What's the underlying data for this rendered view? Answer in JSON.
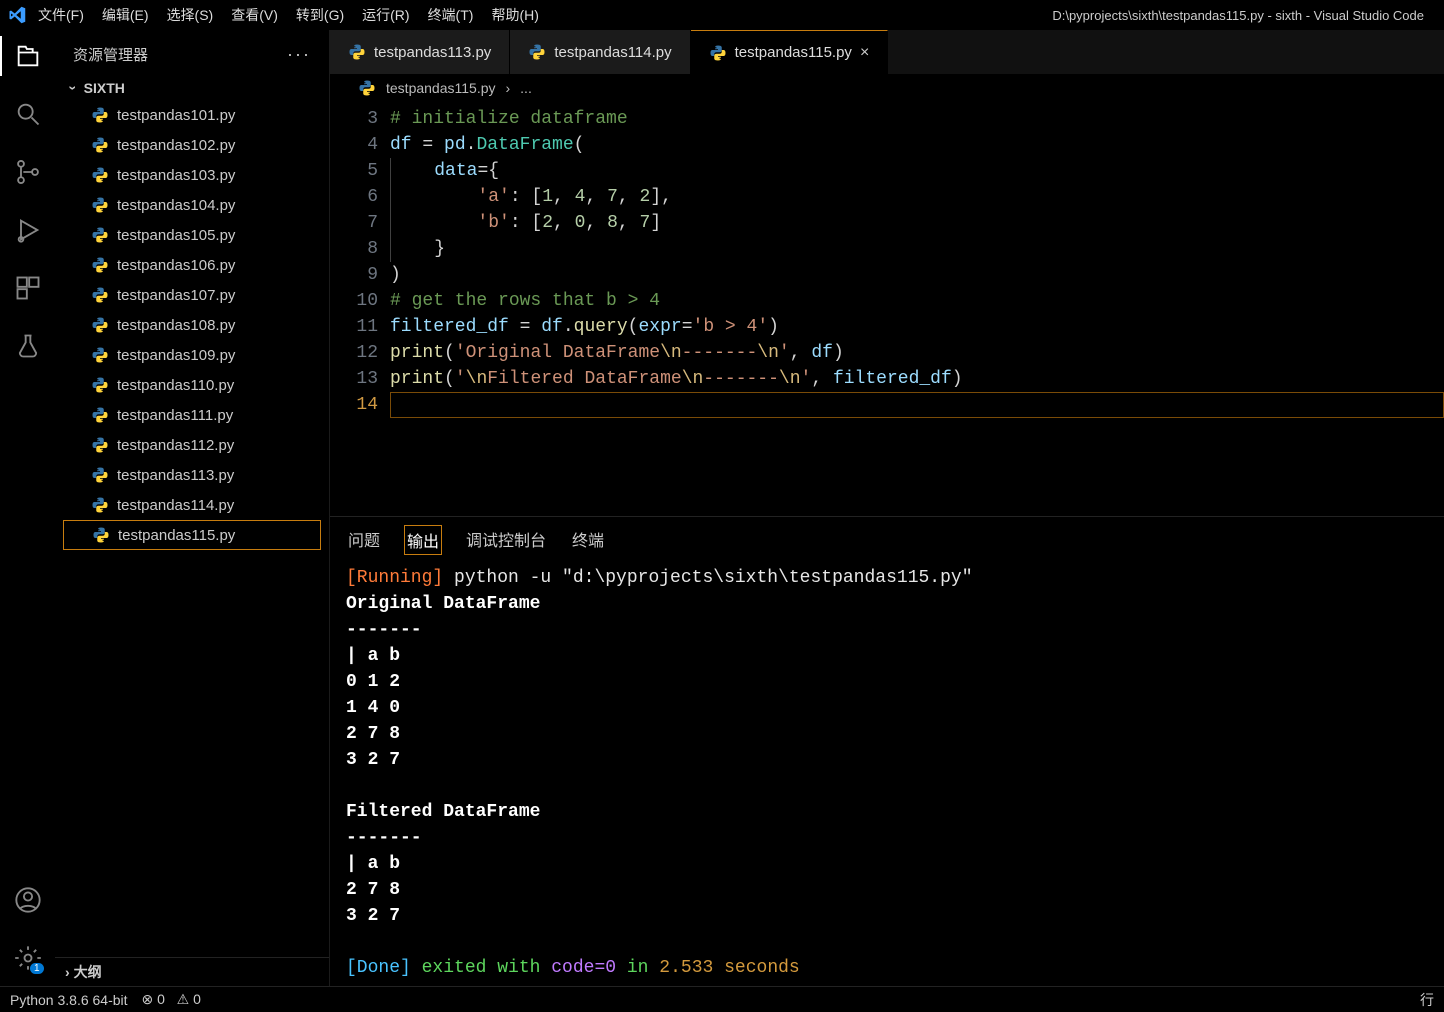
{
  "window": {
    "title": "D:\\pyprojects\\sixth\\testpandas115.py - sixth - Visual Studio Code"
  },
  "menu": {
    "file": "文件(F)",
    "edit": "编辑(E)",
    "select": "选择(S)",
    "view": "查看(V)",
    "goto": "转到(G)",
    "run": "运行(R)",
    "terminal": "终端(T)",
    "help": "帮助(H)"
  },
  "sidebar": {
    "title": "资源管理器",
    "dots": "···",
    "folder": "SIXTH",
    "outline": "大纲",
    "files": [
      "testpandas101.py",
      "testpandas102.py",
      "testpandas103.py",
      "testpandas104.py",
      "testpandas105.py",
      "testpandas106.py",
      "testpandas107.py",
      "testpandas108.py",
      "testpandas109.py",
      "testpandas110.py",
      "testpandas111.py",
      "testpandas112.py",
      "testpandas113.py",
      "testpandas114.py",
      "testpandas115.py"
    ],
    "activeFile": "testpandas115.py"
  },
  "tabs": [
    {
      "label": "testpandas113.py",
      "active": false
    },
    {
      "label": "testpandas114.py",
      "active": false
    },
    {
      "label": "testpandas115.py",
      "active": true
    }
  ],
  "breadcrumb": {
    "file": "testpandas115.py",
    "sep": "›",
    "rest": "..."
  },
  "code": {
    "startLine": 3,
    "tokens": {
      "l3_comment": "# initialize dataframe",
      "l4_df": "df",
      "l4_eq": " = ",
      "l4_pd": "pd",
      "l4_dot": ".",
      "l4_dataframe": "DataFrame",
      "l4_paren": "(",
      "l5_data": "data",
      "l5_rest": "={",
      "l6_key": "'a'",
      "l6_mid": ": [",
      "l6_n1": "1",
      "l6_n2": "4",
      "l6_n3": "7",
      "l6_n4": "2",
      "l6_tail": "],",
      "l7_key": "'b'",
      "l7_mid": ": [",
      "l7_n1": "2",
      "l7_n2": "0",
      "l7_n3": "8",
      "l7_n4": "7",
      "l7_tail": "]",
      "l8_brace": "}",
      "l9_paren": ")",
      "l10_comment": "# get the rows that b > 4",
      "l11_fd": "filtered_df",
      "l11_eq": " = ",
      "l11_df": "df",
      "l11_dot": ".",
      "l11_query": "query",
      "l11_open": "(",
      "l11_expr": "expr",
      "l11_assign": "=",
      "l11_str": "'b > 4'",
      "l11_close": ")",
      "l12_print": "print",
      "l12_open": "(",
      "l12_str": "'Original DataFrame",
      "l12_esc1": "\\n",
      "l12_str2": "-------",
      "l12_esc2": "\\n",
      "l12_strend": "'",
      "l12_comma": ", ",
      "l12_df": "df",
      "l12_close": ")",
      "l13_print": "print",
      "l13_open": "(",
      "l13_strstart": "'",
      "l13_esc0": "\\n",
      "l13_str": "Filtered DataFrame",
      "l13_esc1": "\\n",
      "l13_str2": "-------",
      "l13_esc2": "\\n",
      "l13_strend": "'",
      "l13_comma": ", ",
      "l13_fd": "filtered_df",
      "l13_close": ")"
    }
  },
  "panel": {
    "tabs": {
      "problems": "问题",
      "output": "输出",
      "debug": "调试控制台",
      "terminal": "终端"
    },
    "activeTab": "output"
  },
  "output": {
    "running_prefix": "[Running]",
    "running_cmd": " python -u \"d:\\pyprojects\\sixth\\testpandas115.py\"",
    "orig_title": "Original DataFrame",
    "dashes": "-------",
    "pipe_header": "|   a  b",
    "rows": [
      "0  1  2",
      "1  4  0",
      "2  7  8",
      "3  2  7"
    ],
    "filt_title": "Filtered DataFrame",
    "filt_header": "|   a  b",
    "filt_rows": [
      "2  7  8",
      "3  2  7"
    ],
    "done_prefix": "[Done]",
    "done_mid": " exited with ",
    "code_label": "code=",
    "code_val": "0",
    "in_label": " in ",
    "time": "2.533 seconds"
  },
  "statusbar": {
    "python": "Python 3.8.6 64-bit",
    "err_icon": "⊗",
    "err_count": "0",
    "warn_icon": "⚠",
    "warn_count": "0",
    "line_label": "行"
  }
}
